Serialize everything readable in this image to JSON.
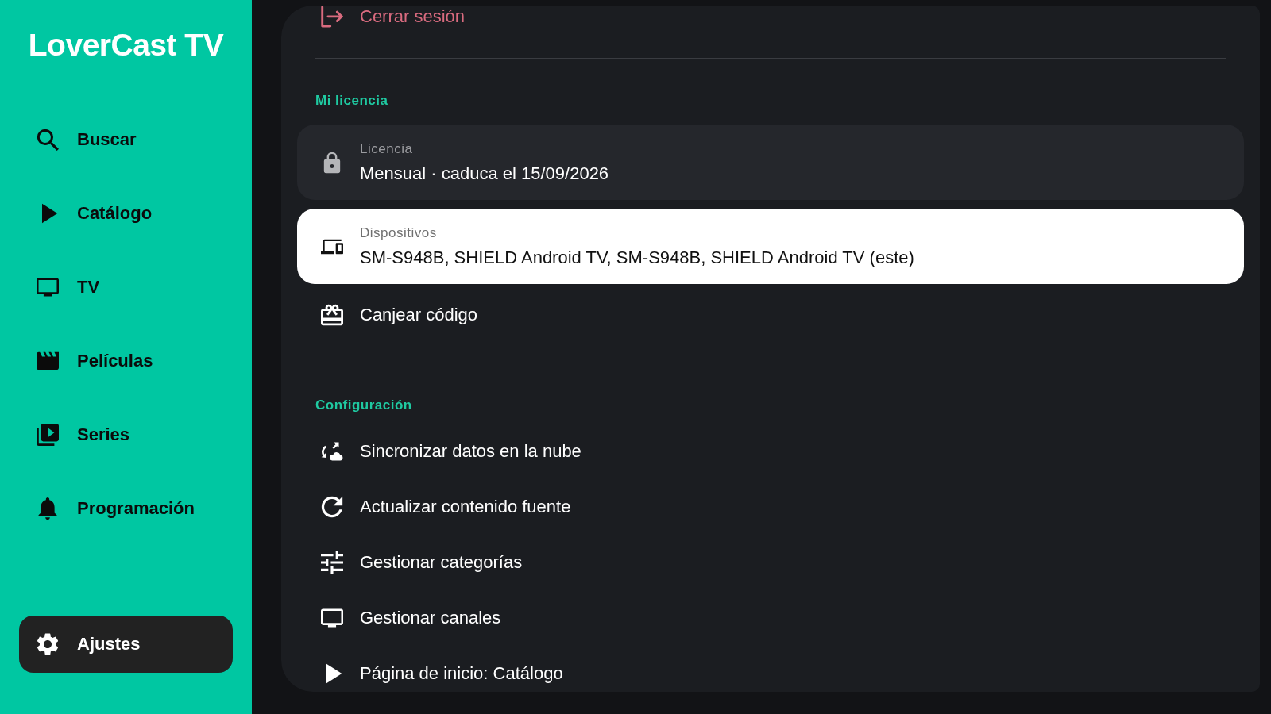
{
  "sidebar": {
    "logo": "LoverCast TV",
    "items": [
      {
        "label": "Buscar",
        "selected": false
      },
      {
        "label": "Catálogo",
        "selected": false
      },
      {
        "label": "TV",
        "selected": false
      },
      {
        "label": "Películas",
        "selected": false
      },
      {
        "label": "Series",
        "selected": false
      },
      {
        "label": "Programación",
        "selected": false
      }
    ],
    "bottom_items": [
      {
        "label": "Ajustes",
        "selected": true
      }
    ]
  },
  "settings": {
    "logout": {
      "label": "Cerrar sesión"
    },
    "sections": [
      {
        "heading": "Mi licencia",
        "items": [
          {
            "kind": "detail",
            "label": "Licencia",
            "value": "Mensual · caduca el 15/09/2026",
            "selected": false
          },
          {
            "kind": "detail",
            "label": "Dispositivos",
            "value": "SM-S948B, SHIELD Android TV, SM-S948B, SHIELD Android TV (este)",
            "selected": true
          },
          {
            "kind": "action",
            "label": "Canjear código",
            "selected": false
          }
        ]
      },
      {
        "heading": "Configuración",
        "items": [
          {
            "kind": "action",
            "label": "Sincronizar datos en la nube",
            "selected": false
          },
          {
            "kind": "action",
            "label": "Actualizar contenido fuente",
            "selected": false
          },
          {
            "kind": "action",
            "label": "Gestionar categorías",
            "selected": false
          },
          {
            "kind": "action",
            "label": "Gestionar canales",
            "selected": false
          },
          {
            "kind": "action",
            "label": "Página de inicio: Catálogo",
            "selected": false
          }
        ]
      }
    ]
  }
}
